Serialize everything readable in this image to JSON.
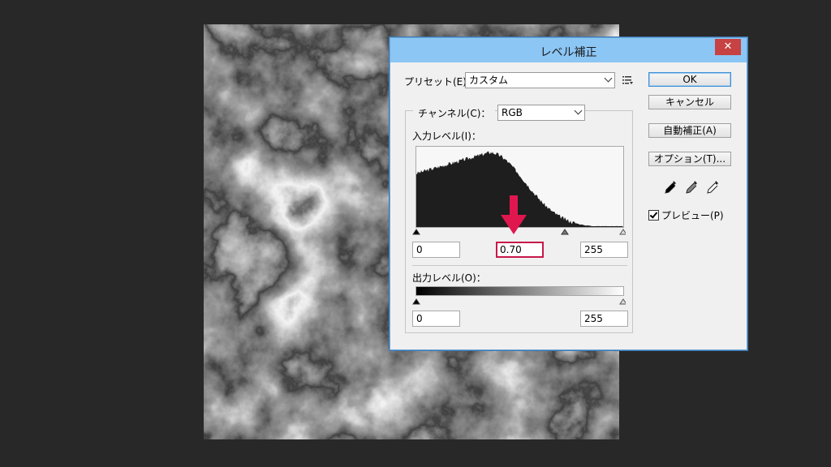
{
  "dialog": {
    "title": "レベル補正",
    "close_glyph": "✕",
    "preset_label": "プリセット(E)：",
    "preset_value": "カスタム",
    "channel_label": "チャンネル(C)：",
    "channel_value": "RGB",
    "input_levels_label": "入力レベル(I)：",
    "input_black": "0",
    "input_gamma": "0.70",
    "input_white": "255",
    "output_levels_label": "出力レベル(O)：",
    "output_black": "0",
    "output_white": "255",
    "buttons": {
      "ok": "OK",
      "cancel": "キャンセル",
      "auto": "自動補正(A)",
      "options": "オプション(T)..."
    },
    "preview_label": "プレビュー(P)",
    "preview_checked": true
  },
  "colors": {
    "background": "#282828",
    "titlebar": "#8cc6f5",
    "close_button": "#c74242",
    "highlight": "#c8184a",
    "arrow": "#e0174f"
  },
  "icons": [
    "preset-menu-icon",
    "black-eyedropper-icon",
    "gray-eyedropper-icon",
    "white-eyedropper-icon",
    "down-arrow-annotation-icon"
  ]
}
